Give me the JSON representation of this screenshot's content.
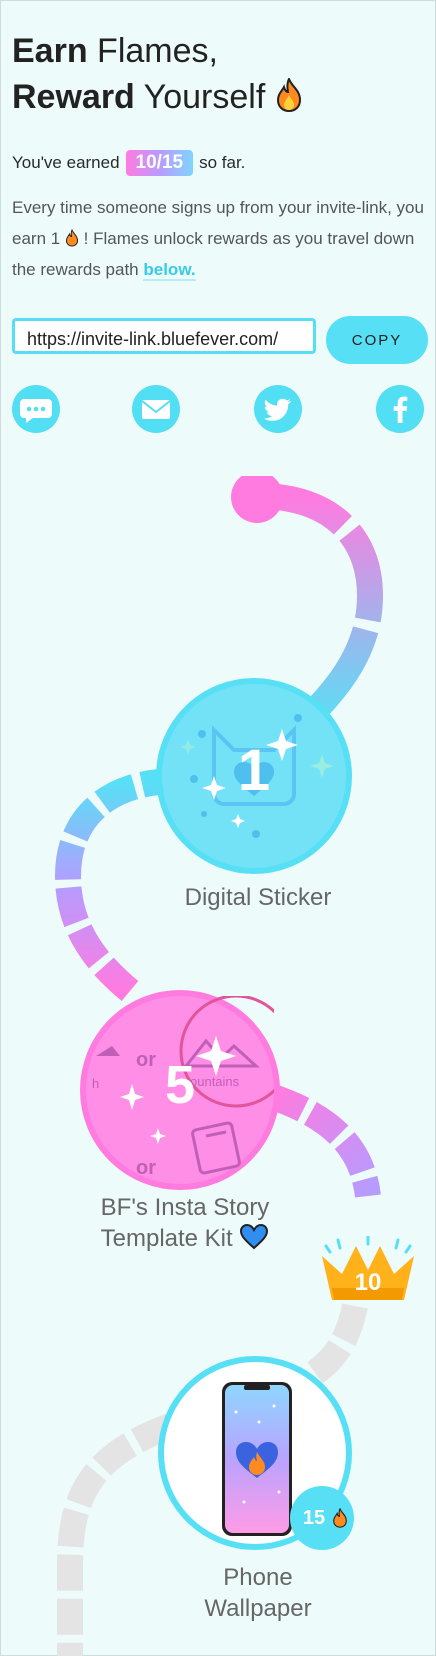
{
  "header": {
    "line1_bold": "Earn",
    "line1_light": "Flames,",
    "line2_bold": "Reward",
    "line2_light": "Yourself"
  },
  "progress": {
    "prefix": "You've earned",
    "value": "10/15",
    "suffix": "so far."
  },
  "description": {
    "part1": "Every time someone signs up from your invite-link, you earn 1",
    "part2": "! Flames unlock rewards as you travel down the rewards path",
    "link": "below."
  },
  "invite": {
    "url": "https://invite-link.bluefever.com/",
    "copy_label": "COPY"
  },
  "share_icons": [
    "chat-icon",
    "mail-icon",
    "twitter-icon",
    "facebook-icon"
  ],
  "rewards": [
    {
      "badge": "1",
      "label": "Digital Sticker",
      "unlocked": true
    },
    {
      "badge": "5",
      "label_line1": "BF's Insta Story",
      "label_line2": "Template Kit",
      "unlocked": true
    },
    {
      "crown": "10"
    },
    {
      "badge": "15",
      "label_line1": "Phone",
      "label_line2": "Wallpaper",
      "unlocked": false
    }
  ],
  "sticker_words": {
    "or1": "or",
    "or2": "or",
    "mountains": "ountains",
    "h": "h"
  },
  "colors": {
    "cyan": "#57e0f5",
    "pink": "#ff7be0",
    "purple": "#b99bff",
    "background": "#eefbfb",
    "locked": "#e4e4e4"
  }
}
